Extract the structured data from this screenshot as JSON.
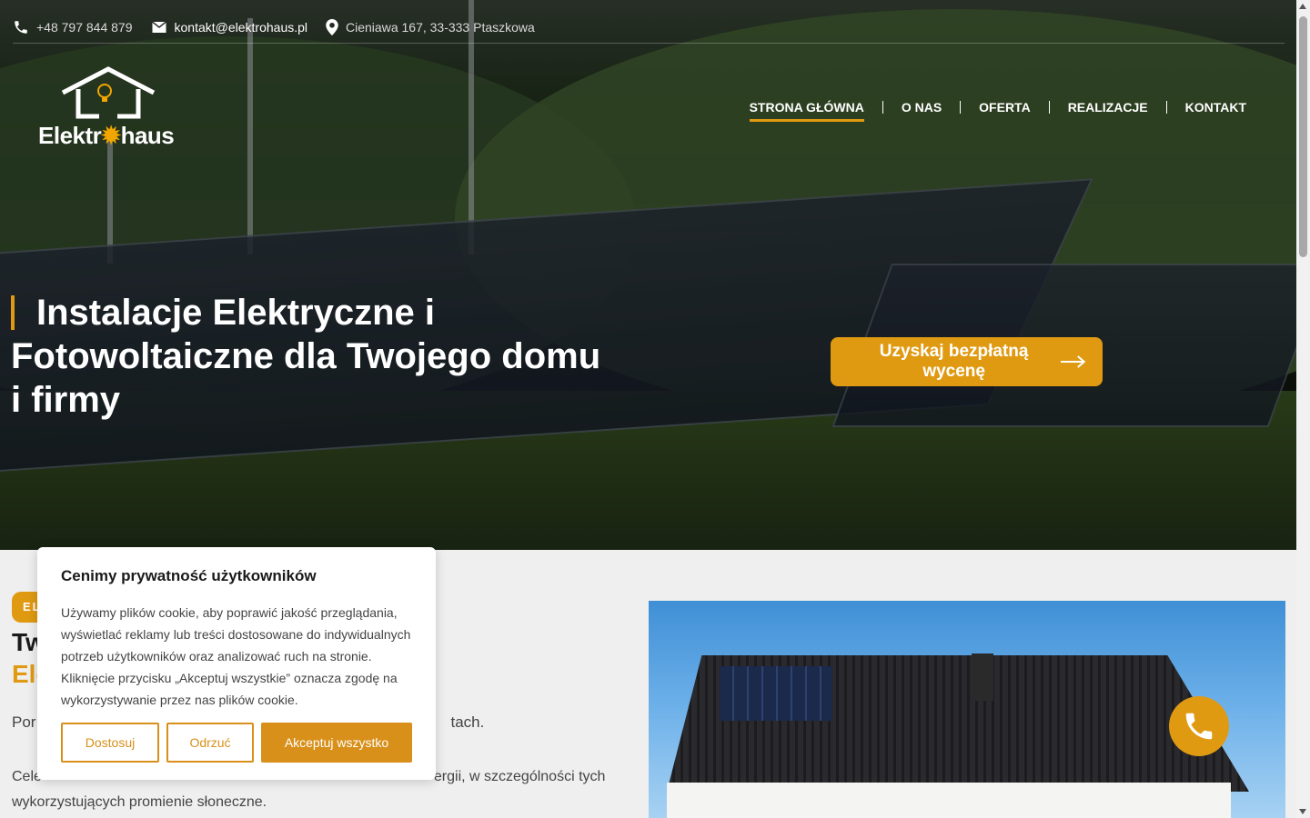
{
  "topbar": {
    "phone": "+48 797 844 879",
    "email": "kontakt@elektrohaus.pl",
    "address": "Cieniawa 167, 33-333 Ptaszkowa",
    "phone_icon": "phone-icon",
    "email_icon": "mail-icon",
    "address_icon": "location-pin-icon"
  },
  "logo": {
    "text_before": "Elektr",
    "text_after": "haus"
  },
  "nav": {
    "items": [
      {
        "label": "STRONA GŁÓWNA"
      },
      {
        "label": "O NAS"
      },
      {
        "label": "OFERTA"
      },
      {
        "label": "REALIZACJE"
      },
      {
        "label": "KONTAKT"
      }
    ]
  },
  "hero": {
    "title": "Instalacje Elektryczne i Fotowoltaiczne dla Twojego domu i firmy",
    "cta_label": "Uzyskaj bezpłatną wycenę"
  },
  "content": {
    "badge": "ELEKTROHAUS",
    "heading_line1": "Tw",
    "heading_line2": "Ele",
    "para1_prefix": "Por",
    "para1_suffix": "tach.",
    "para2_prefix": "Cele",
    "para2_suffix": "ergii, w szczególności tych",
    "para2_line2": "wykorzystujących promienie słoneczne."
  },
  "cookie": {
    "title": "Cenimy prywatność użytkowników",
    "body": "Używamy plików cookie, aby poprawić jakość przeglądania, wyświetlać reklamy lub treści dostosowane do indywidualnych potrzeb użytkowników oraz analizować ruch na stronie. Kliknięcie przycisku „Akceptuj wszystkie” oznacza zgodę na wykorzystywanie przez nas plików cookie.",
    "customize": "Dostosuj",
    "reject": "Odrzuć",
    "accept": "Akceptuj wszystko"
  },
  "colors": {
    "accent": "#e09a12",
    "cookie_accent": "#d8901a"
  }
}
